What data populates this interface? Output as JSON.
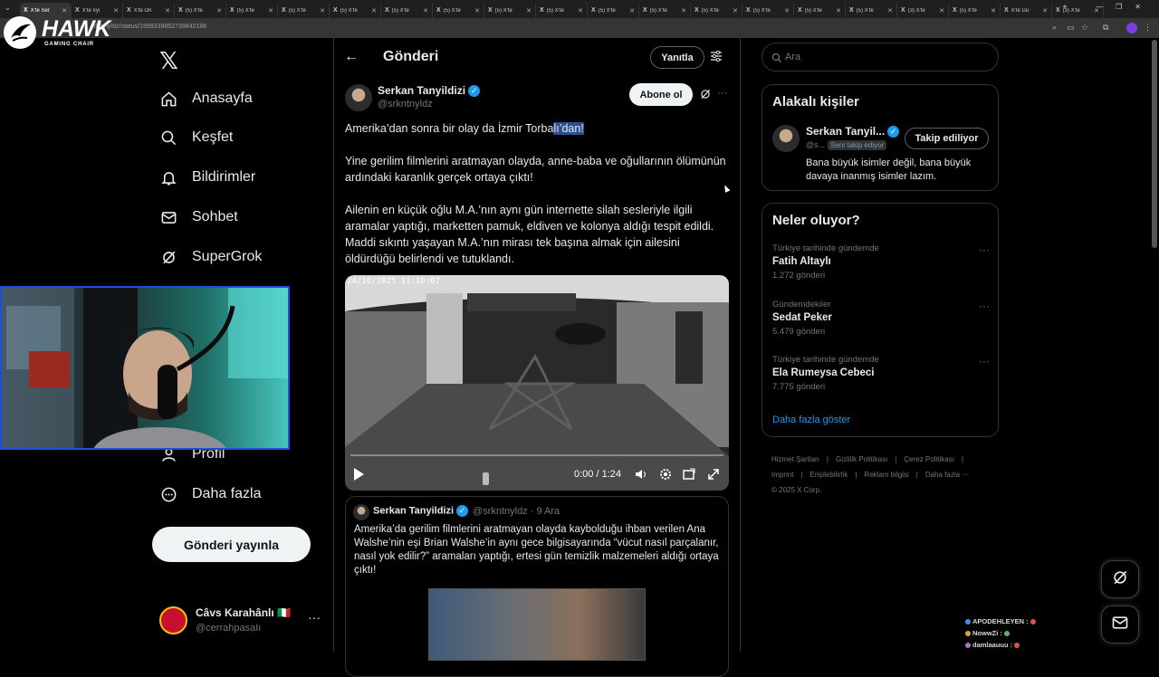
{
  "browser": {
    "tabs": [
      {
        "label": "X'te Ser",
        "active": true
      },
      {
        "label": "X'te Iıyı"
      },
      {
        "label": "X'te Ön"
      },
      {
        "label": "(5) X'te"
      },
      {
        "label": "(5) X'te"
      },
      {
        "label": "(5) X'te"
      },
      {
        "label": "(5) X'te"
      },
      {
        "label": "(5) X'te"
      },
      {
        "label": "(5) X'te"
      },
      {
        "label": "(5) X'te"
      },
      {
        "label": "(5) X'te"
      },
      {
        "label": "(5) X'te"
      },
      {
        "label": "(5) X'te"
      },
      {
        "label": "(5) X'te"
      },
      {
        "label": "(5) X'te"
      },
      {
        "label": "(5) X'te"
      },
      {
        "label": "(5) X'te"
      },
      {
        "label": "(3) X'te"
      },
      {
        "label": "(5) X'te"
      },
      {
        "label": "X'te Du"
      },
      {
        "label": "(3) X'te"
      }
    ],
    "url": "srkntnyldz/status/1999339852739842188"
  },
  "watermark": {
    "name": "HAWK",
    "subtitle": "GAMING CHAIR"
  },
  "nav": {
    "items": [
      {
        "label": "Anasayfa",
        "icon": "home-icon"
      },
      {
        "label": "Keşfet",
        "icon": "search-icon"
      },
      {
        "label": "Bildirimler",
        "icon": "bell-icon"
      },
      {
        "label": "Sohbet",
        "icon": "mail-icon"
      },
      {
        "label": "SuperGrok",
        "icon": "grok-icon"
      },
      {
        "label": "Profil",
        "icon": "person-icon"
      },
      {
        "label": "Daha fazla",
        "icon": "more-circle-icon"
      }
    ],
    "post_button": "Gönderi yayınla",
    "account": {
      "name": "Câvs Karahânlı 🇮🇹",
      "handle": "@cerrahpasaIı"
    }
  },
  "post_header": {
    "title": "Gönderi",
    "reply_button": "Yanıtla"
  },
  "post": {
    "author_name": "Serkan Tanyildizi",
    "author_handle": "@srkntnyldz",
    "subscribe_button": "Abone ol",
    "line1_a": "Amerika’dan sonra bir olay da İzmir Torba",
    "line1_b": "lı’dan!",
    "para2": "Yine gerilim filmlerini aratmayan olayda, anne-baba ve oğullarının ölümünün ardındaki karanlık gerçek ortaya çıktı!",
    "para3": "Ailenin en küçük oğlu M.A.’nın aynı gün internette silah sesleriyle ilgili aramalar yaptığı, marketten pamuk, eldiven ve kolonya aldığı tespit edildi. Maddi sıkıntı yaşayan M.A.’nın mirası tek başına almak için ailesini öldürdüğü belirlendi ve tutuklandı.",
    "video": {
      "timestamp": "24/10/2025 11:16:07",
      "time": "0:00 / 1:24",
      "progress": 0
    }
  },
  "quote": {
    "author_name": "Serkan Tanyildizi",
    "author_meta": "@srkntnyldz · 9 Ara",
    "text": "Amerika’da gerilim filmlerini aratmayan olayda kaybolduğu ihban verilen Ana Walshe’nin eşi Brian Walshe’in aynı gece bilgisayarında “vücut nasıl parçalanır, nasıl yok edilir?” aramaları yaptığı, ertesi gün temizlik malzemeleri aldığı ortaya çıktı!"
  },
  "search": {
    "placeholder": "Ara"
  },
  "related": {
    "title": "Alakalı kişiler",
    "name": "Serkan Tanyil...",
    "handle": "@s...",
    "follows_you": "Seni takip ediyor",
    "follow_button": "Takip ediliyor",
    "bio": "Bana büyük isimler değil, bana büyük davaya inanmış isimler lazım."
  },
  "trends": {
    "title": "Neler oluyor?",
    "items": [
      {
        "context": "Türkiye tarihinde gündemde",
        "name": "Fatih Altaylı",
        "count": "1.272 gönderi"
      },
      {
        "context": "Gündemdekiler",
        "name": "Sedat Peker",
        "count": "5.479 gönderi"
      },
      {
        "context": "Türkiye tarihinde gündemde",
        "name": "Ela Rumeysa Cebeci",
        "count": "7.775 gönderi"
      }
    ],
    "show_more": "Daha fazla göster"
  },
  "footer": {
    "links": [
      "Hizmet Şartları",
      "Gizlilik Politikası",
      "Çerez Politikası",
      "Imprint",
      "Erişilebilirlik",
      "Reklam bilgisi",
      "Daha fazla ···"
    ],
    "copyright": "© 2025 X Corp."
  },
  "chat": [
    {
      "user": "APODEHLEYEN :",
      "color": "#4a90e2"
    },
    {
      "user": "NowwZi :",
      "color": "#e0a040"
    },
    {
      "user": "damlaauuu :",
      "color": "#b070d0"
    }
  ]
}
